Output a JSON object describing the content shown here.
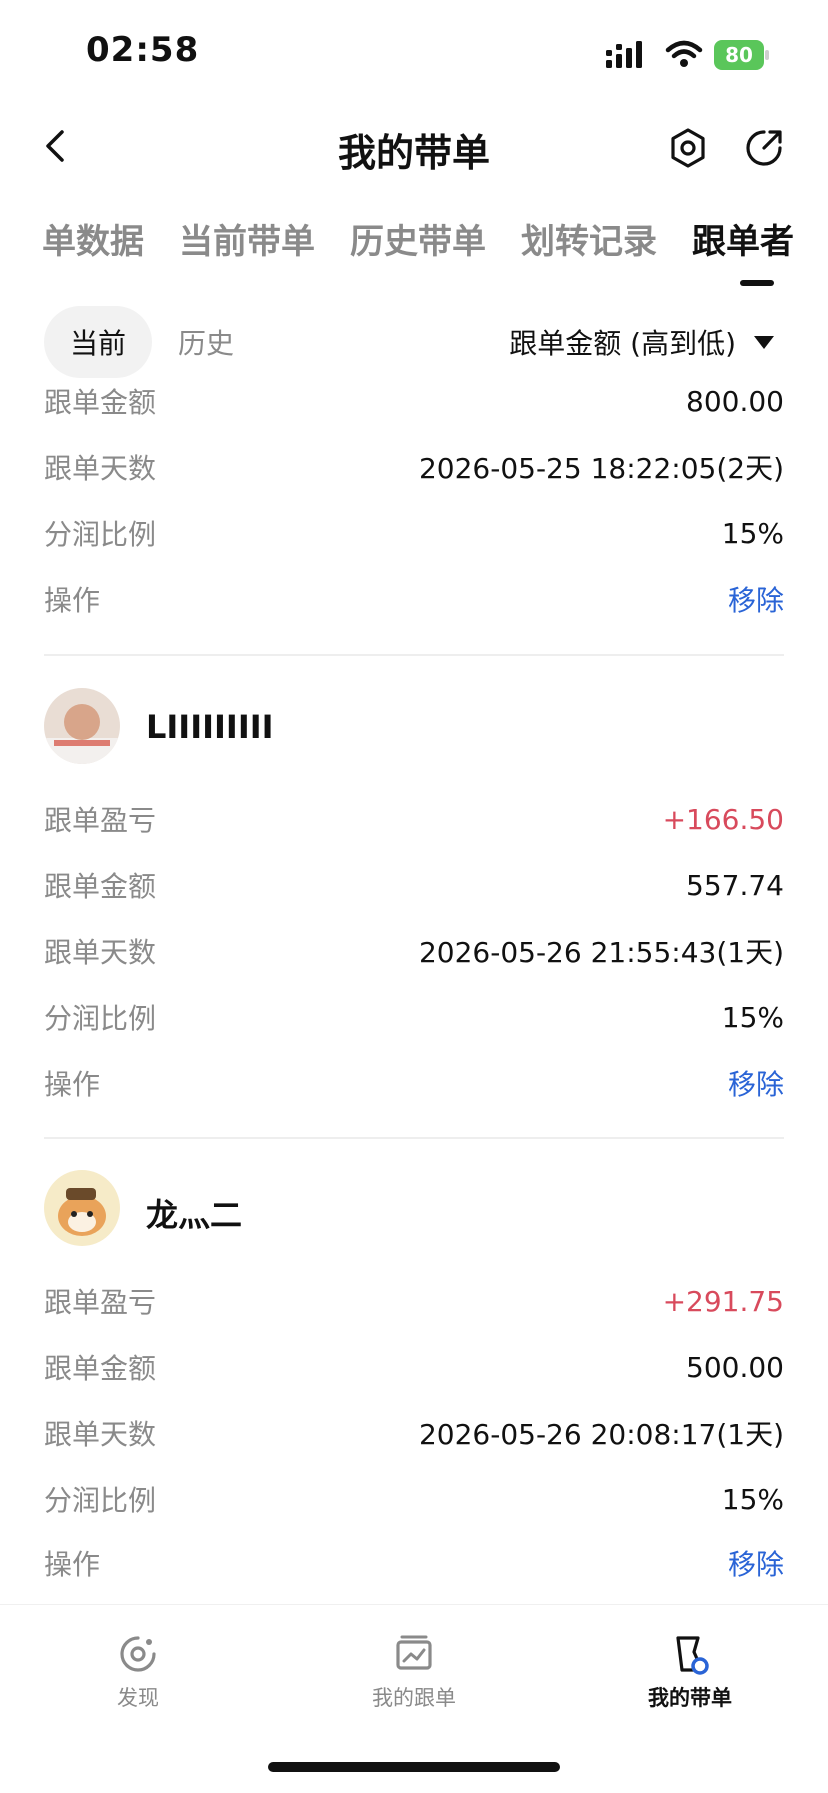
{
  "status_bar": {
    "time": "02:58",
    "battery": "80"
  },
  "nav": {
    "title": "我的带单"
  },
  "tabs": [
    {
      "label": "单数据"
    },
    {
      "label": "当前带单"
    },
    {
      "label": "历史带单"
    },
    {
      "label": "划转记录"
    },
    {
      "label": "跟单者"
    }
  ],
  "filter": {
    "current": "当前",
    "history": "历史",
    "sort": "跟单金额 (高到低)"
  },
  "followers": [
    {
      "rows": [
        {
          "label": "跟单金额",
          "value": "800.00"
        },
        {
          "label": "跟单天数",
          "value": "2026-05-25 18:22:05(2天)"
        },
        {
          "label": "分润比例",
          "value": "15%"
        },
        {
          "label": "操作",
          "value": "移除"
        }
      ]
    },
    {
      "name": "LIIIIIIIII",
      "rows": [
        {
          "label": "跟单盈亏",
          "value": "+166.50"
        },
        {
          "label": "跟单金额",
          "value": "557.74"
        },
        {
          "label": "跟单天数",
          "value": "2026-05-26 21:55:43(1天)"
        },
        {
          "label": "分润比例",
          "value": "15%"
        },
        {
          "label": "操作",
          "value": "移除"
        }
      ]
    },
    {
      "name": "龙灬二",
      "rows": [
        {
          "label": "跟单盈亏",
          "value": "+291.75"
        },
        {
          "label": "跟单金额",
          "value": "500.00"
        },
        {
          "label": "跟单天数",
          "value": "2026-05-26 20:08:17(1天)"
        },
        {
          "label": "分润比例",
          "value": "15%"
        },
        {
          "label": "操作",
          "value": "移除"
        }
      ]
    }
  ],
  "bottom_nav": [
    {
      "label": "发现",
      "icon": "discover-icon"
    },
    {
      "label": "我的跟单",
      "icon": "chart-icon"
    },
    {
      "label": "我的带单",
      "icon": "lead-icon"
    }
  ],
  "colors": {
    "profit": "#d84a5c",
    "link": "#2a64d6",
    "muted": "#8a8a8a"
  }
}
